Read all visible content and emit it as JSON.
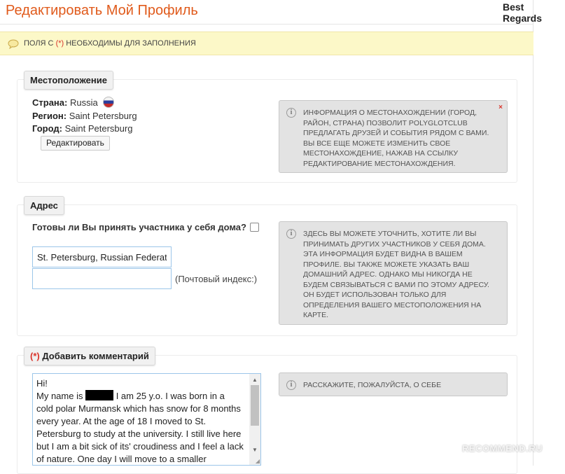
{
  "header": {
    "page_title": "Редактировать Мой Профиль",
    "side_user": "Best Regards"
  },
  "notice": {
    "prefix": "ПОЛЯ С ",
    "mark": "(*)",
    "suffix": " НЕОБХОДИМЫ ДЛЯ ЗАПОЛНЕНИЯ"
  },
  "location": {
    "legend": "Местоположение",
    "country_label": "Страна:",
    "country_value": "Russia",
    "country_flag_icon": "russia-flag-icon",
    "region_label": "Регион:",
    "region_value": "Saint Petersburg",
    "city_label": "Город:",
    "city_value": "Saint Petersburg",
    "edit_button": "Редактировать",
    "help_text": "ИНФОРМАЦИЯ О МЕСТОНАХОЖДЕНИИ (ГОРОД, РАЙОН, СТРАНА) ПОЗВОЛИТ POLYGLOTCLUB ПРЕДЛАГАТЬ ДРУЗЕЙ И СОБЫТИЯ РЯДОМ С ВАМИ. ВЫ ВСЕ ЕЩЕ МОЖЕТЕ ИЗМЕНИТЬ СВОЕ МЕСТОНАХОЖДЕНИЕ, НАЖАВ НА ССЫЛКУ РЕДАКТИРОВАНИЕ МЕСТОНАХОЖДЕНИЯ.",
    "help_close": "×"
  },
  "address": {
    "legend": "Адрес",
    "host_question": "Готовы ли Вы принять участника у себя дома?",
    "address_value": "St. Petersburg, Russian Federat",
    "postal_value": "",
    "postal_label": "(Почтовый индекс:)",
    "help_text": "ЗДЕСЬ ВЫ МОЖЕТЕ УТОЧНИТЬ, ХОТИТЕ ЛИ ВЫ ПРИНИМАТЬ ДРУГИХ УЧАСТНИКОВ У СЕБЯ ДОМА. ЭТА ИНФОРМАЦИЯ БУДЕТ ВИДНА В ВАШЕМ ПРОФИЛЕ. ВЫ ТАКЖЕ МОЖЕТЕ УКАЗАТЬ ВАШ ДОМАШНИЙ АДРЕС. ОДНАКО МЫ НИКОГДА НЕ БУДЕМ СВЯЗЫВАТЬСЯ С ВАМИ ПО ЭТОМУ АДРЕСУ. ОН БУДЕТ ИСПОЛЬЗОВАН ТОЛЬКО ДЛЯ ОПРЕДЕЛЕНИЯ ВАШЕГО МЕСТОПОЛОЖЕНИЯ НА КАРТЕ."
  },
  "comment": {
    "legend_mark": "(*)",
    "legend": " Добавить комментарий",
    "line1": "Hi!",
    "line2_before": "My name is ",
    "line2_after": " I am 25 y.o. I was born in a",
    "rest": "cold polar Murmansk which has snow for 8 months every year. At the age of 18 I moved to St. Petersburg to study at the university. I still live here but I am a bit sick of its' croudiness and I feel a lack of nature. One day I will move to a smaller",
    "help_text": "РАССКАЖИТЕ, ПОЖАЛУЙСТА, О СЕБЕ"
  },
  "watermark": "RECOMMEND.RU",
  "colors": {
    "title": "#e05a1b",
    "required_mark": "#d9342b",
    "notice_bg": "#fcf8c8",
    "help_bg": "#e3e3e3",
    "input_border": "#9cc6e9"
  }
}
